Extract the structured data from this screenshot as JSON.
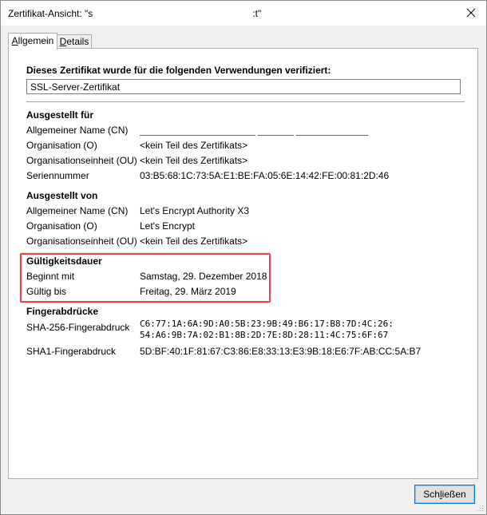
{
  "window": {
    "title": "Zertifikat-Ansicht: \"s                                                            :t\"",
    "close_icon": "close-icon"
  },
  "tabs": [
    {
      "label_underlined": "A",
      "label_rest": "llgemein"
    },
    {
      "label_underlined": "D",
      "label_rest": "etails"
    }
  ],
  "usage": {
    "heading": "Dieses Zertifikat wurde für die folgenden Verwendungen verifiziert:",
    "value": "SSL-Server-Zertifikat"
  },
  "issued_to": {
    "heading": "Ausgestellt für",
    "rows": [
      {
        "label": "Allgemeiner Name (CN)",
        "value": ""
      },
      {
        "label": "Organisation (O)",
        "value": "<kein Teil des Zertifikats>"
      },
      {
        "label": "Organisationseinheit (OU)",
        "value": "<kein Teil des Zertifikats>"
      },
      {
        "label": "Seriennummer",
        "value": "03:B5:68:1C:73:5A:E1:BE:FA:05:6E:14:42:FE:00:81:2D:46"
      }
    ]
  },
  "issued_by": {
    "heading": "Ausgestellt von",
    "rows": [
      {
        "label": "Allgemeiner Name (CN)",
        "value": "Let's Encrypt Authority X3"
      },
      {
        "label": "Organisation (O)",
        "value": "Let's Encrypt"
      },
      {
        "label": "Organisationseinheit (OU)",
        "value": "<kein Teil des Zertifikats>"
      }
    ]
  },
  "validity": {
    "heading": "Gültigkeitsdauer",
    "rows": [
      {
        "label": "Beginnt mit",
        "value": "Samstag, 29. Dezember 2018"
      },
      {
        "label": "Gültig bis",
        "value": "Freitag, 29. März 2019"
      }
    ]
  },
  "fingerprints": {
    "heading": "Fingerabdrücke",
    "rows": [
      {
        "label": "SHA-256-Fingerabdruck",
        "line1": "C6:77:1A:6A:9D:A0:5B:23:9B:49:B6:17:B8:7D:4C:26:",
        "line2": "54:A6:9B:7A:02:B1:8B:2D:7E:8D:28:11:4C:75:6F:67"
      },
      {
        "label": "SHA1-Fingerabdruck",
        "value": "5D:BF:40:1F:81:67:C3:86:E8:33:13:E3:9B:18:E6:7F:AB:CC:5A:B7"
      }
    ]
  },
  "footer": {
    "close_button_underlined": "l",
    "close_button_pre": "Sch",
    "close_button_post": "ießen"
  },
  "colors": {
    "highlight": "#e04a4a",
    "redaction_underline": "#2b6fcf",
    "button_focus": "#0078d7"
  }
}
